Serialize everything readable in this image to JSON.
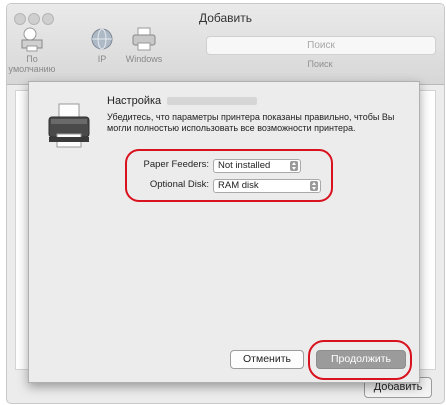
{
  "window": {
    "title": "Добавить"
  },
  "toolbar": {
    "default_label": "По умолчанию",
    "ip_label": "IP",
    "windows_label": "Windows",
    "search_placeholder": "Поиск",
    "search_label": "Поиск"
  },
  "footer": {
    "add_label": "Добавить"
  },
  "sheet": {
    "heading": "Настройка",
    "description": "Убедитесь, что параметры принтера показаны правильно, чтобы Вы могли полностью использовать все возможности принтера.",
    "options": [
      {
        "label": "Paper Feeders:",
        "value": "Not installed"
      },
      {
        "label": "Optional Disk:",
        "value": "RAM disk"
      }
    ],
    "cancel_label": "Отменить",
    "continue_label": "Продолжить"
  },
  "colors": {
    "annotation": "#d8131f"
  },
  "icons": [
    "printer-icon",
    "globe-icon",
    "stepper-icon"
  ]
}
